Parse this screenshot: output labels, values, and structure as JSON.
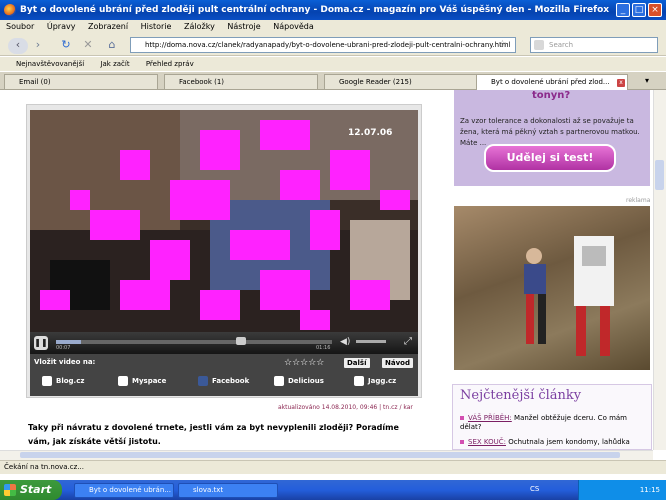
{
  "window": {
    "title": "Byt o dovolené ubrání před zloději pult centrální ochrany - Doma.cz - magazín pro Váš úspěšný den - Mozilla Firefox"
  },
  "menu": [
    "Soubor",
    "Úpravy",
    "Zobrazení",
    "Historie",
    "Záložky",
    "Nástroje",
    "Nápověda"
  ],
  "nav": {
    "url": "http://doma.nova.cz/clanek/radyanapady/byt-o-dovolene-ubrani-pred-zlodeji-pult-centralni-ochrany.html",
    "search_placeholder": "Search"
  },
  "bookmarks": [
    "Nejnavštěvovanější",
    "Jak začít",
    "Přehled zpráv"
  ],
  "tabs": [
    {
      "label": "Email (0)"
    },
    {
      "label": "Facebook (1)"
    },
    {
      "label": "Google Reader (215)"
    },
    {
      "label": "Byt o dovolené ubrání před zlod..."
    }
  ],
  "video": {
    "timestamp": "12.07.06",
    "time_current": "00:07",
    "time_total": "01:16",
    "embed_label": "Vložit video na:",
    "next_label": "Další",
    "help_label": "Návod",
    "stars": "☆☆☆☆☆",
    "share": [
      "Blog.cz",
      "Myspace",
      "Facebook",
      "Delicious",
      "Jagg.cz"
    ]
  },
  "article": {
    "meta": "aktualizováno 14.08.2010, 09:46 | tn.cz / kar",
    "lead": "Taky při návratu z dovolené trnete, jestli vám za byt nevyplenili zloději? Poradíme vám, jak získáte větší jistotu."
  },
  "sidebar": {
    "promo_title": "tonyn?",
    "promo_text": "Za vzor tolerance a dokonalosti až se považuje ta žena, která má pěkný vztah s partnerovou matkou. Máte ...",
    "promo_button": "Udělej si test!",
    "ad_label": "reklama",
    "popular_title": "Nejčtenější články",
    "popular": [
      {
        "tag": "VÁŠ PŘÍBĚH:",
        "text": "Manžel obtěžuje dceru. Co mám dělat?"
      },
      {
        "tag": "SEX KOUČ:",
        "text": "Ochutnala jsem kondomy, lahůdka"
      }
    ]
  },
  "status": {
    "text": "Čekání na tn.nova.cz..."
  },
  "taskbar": {
    "start": "Start",
    "tasks": [
      "Byt o dovolené ubrán...",
      "slova.txt"
    ],
    "lang": "CS",
    "clock": "11:15"
  }
}
